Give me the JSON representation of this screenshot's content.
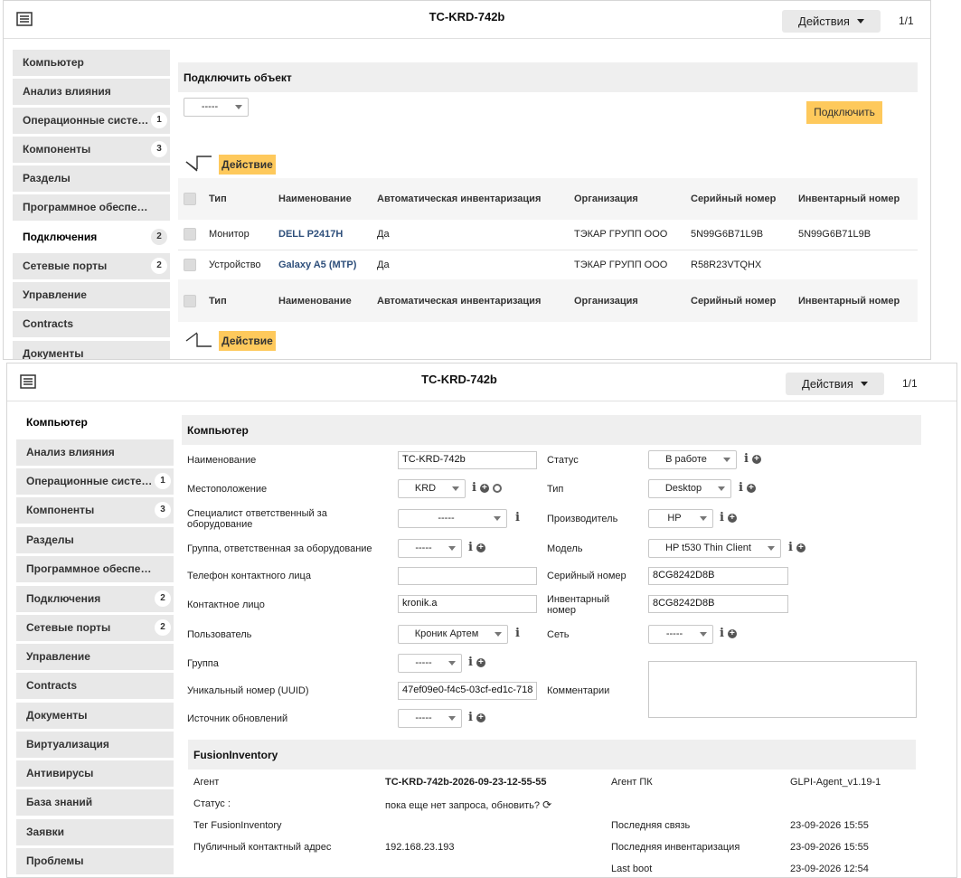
{
  "top_panel": {
    "title": "TC-KRD-742b",
    "actions_label": "Действия",
    "pager": "1/1",
    "sidebar": [
      {
        "label": "Компьютер",
        "badge": ""
      },
      {
        "label": "Анализ влияния",
        "badge": ""
      },
      {
        "label": "Операционные систе…",
        "badge": "1"
      },
      {
        "label": "Компоненты",
        "badge": "3"
      },
      {
        "label": "Разделы",
        "badge": ""
      },
      {
        "label": "Программное обеспе…",
        "badge": ""
      },
      {
        "label": "Подключения",
        "badge": "2"
      },
      {
        "label": "Сетевые порты",
        "badge": "2"
      },
      {
        "label": "Управление",
        "badge": ""
      },
      {
        "label": "Contracts",
        "badge": ""
      },
      {
        "label": "Документы",
        "badge": ""
      }
    ],
    "connect_header": "Подключить объект",
    "connect_select": "-----",
    "connect_button": "Подключить",
    "action_label": "Действие",
    "columns": [
      "Тип",
      "Наименование",
      "Автоматическая инвентаризация",
      "Организация",
      "Серийный номер",
      "Инвентарный номер"
    ],
    "rows": [
      {
        "type": "Монитор",
        "name": "DELL P2417H",
        "auto": "Да",
        "org": "ТЭКАР ГРУПП ООО",
        "serial": "5N99G6B71L9B",
        "inv": "5N99G6B71L9B"
      },
      {
        "type": "Устройство",
        "name": "Galaxy A5 (MTP)",
        "auto": "Да",
        "org": "ТЭКАР ГРУПП ООО",
        "serial": "R58R23VTQHX",
        "inv": ""
      }
    ]
  },
  "bottom_panel": {
    "title": "TC-KRD-742b",
    "actions_label": "Действия",
    "pager": "1/1",
    "sidebar": [
      {
        "label": "Компьютер",
        "badge": ""
      },
      {
        "label": "Анализ влияния",
        "badge": ""
      },
      {
        "label": "Операционные систе…",
        "badge": "1"
      },
      {
        "label": "Компоненты",
        "badge": "3"
      },
      {
        "label": "Разделы",
        "badge": ""
      },
      {
        "label": "Программное обеспе…",
        "badge": ""
      },
      {
        "label": "Подключения",
        "badge": "2"
      },
      {
        "label": "Сетевые порты",
        "badge": "2"
      },
      {
        "label": "Управление",
        "badge": ""
      },
      {
        "label": "Contracts",
        "badge": ""
      },
      {
        "label": "Документы",
        "badge": ""
      },
      {
        "label": "Виртуализация",
        "badge": ""
      },
      {
        "label": "Антивирусы",
        "badge": ""
      },
      {
        "label": "База знаний",
        "badge": ""
      },
      {
        "label": "Заявки",
        "badge": ""
      },
      {
        "label": "Проблемы",
        "badge": ""
      }
    ],
    "form_header": "Компьютер",
    "fields": {
      "name_label": "Наименование",
      "name_value": "TC-KRD-742b",
      "location_label": "Местоположение",
      "location_value": "KRD",
      "tech_label": "Специалист ответственный за оборудование",
      "tech_value": "-----",
      "group_tech_label": "Группа, ответственная за оборудование",
      "group_tech_value": "-----",
      "phone_label": "Телефон контактного лица",
      "phone_value": "",
      "contact_label": "Контактное лицо",
      "contact_value": "kronik.a",
      "user_label": "Пользователь",
      "user_value": "Кроник Артем",
      "group_label": "Группа",
      "group_value": "-----",
      "uuid_label": "Уникальный номер (UUID)",
      "uuid_value": "47ef09e0-f4c5-03cf-ed1c-718",
      "source_label": "Источник обновлений",
      "source_value": "-----",
      "status_label": "Статус",
      "status_value": "В работе",
      "type_label": "Тип",
      "type_value": "Desktop",
      "manufacturer_label": "Производитель",
      "manufacturer_value": "HP",
      "model_label": "Модель",
      "model_value": "HP t530 Thin Client",
      "serial_label": "Серийный номер",
      "serial_value": "8CG8242D8B",
      "inv_label": "Инвентарный номер",
      "inv_value": "8CG8242D8B",
      "network_label": "Сеть",
      "network_value": "-----",
      "comments_label": "Комментарии"
    },
    "fusion": {
      "header": "FusionInventory",
      "agent_label": "Агент",
      "agent_value": "TC-KRD-742b-2026-09-23-12-55-55",
      "agent_pc_label": "Агент ПК",
      "agent_pc_value": "GLPI-Agent_v1.19-1",
      "status_label": "Статус :",
      "status_value": "пока еще нет запроса, обновить?",
      "tag_label": "Тег FusionInventory",
      "last_contact_label": "Последняя связь",
      "last_contact_value": "23-09-2026 15:55",
      "ip_label": "Публичный контактный адрес",
      "ip_value": "192.168.23.193",
      "last_inv_label": "Последняя инвентаризация",
      "last_inv_value": "23-09-2026 15:55",
      "last_boot_label": "Last boot",
      "last_boot_value": "23-09-2026 12:54"
    }
  }
}
